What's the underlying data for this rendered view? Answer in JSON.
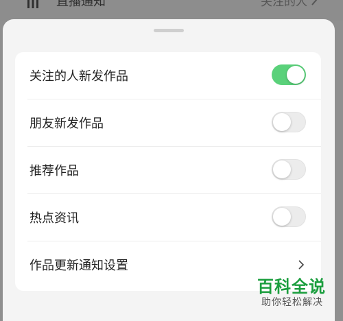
{
  "background_row": {
    "title": "直播通知",
    "value": "关注的人",
    "icon": "bars-icon"
  },
  "settings": {
    "items": [
      {
        "label": "关注的人新发作品",
        "control": "toggle",
        "on": true
      },
      {
        "label": "朋友新发作品",
        "control": "toggle",
        "on": false
      },
      {
        "label": "推荐作品",
        "control": "toggle",
        "on": false
      },
      {
        "label": "热点资讯",
        "control": "toggle",
        "on": false
      },
      {
        "label": "作品更新通知设置",
        "control": "chevron"
      }
    ]
  },
  "watermark": {
    "main": "百科全说",
    "sub": "助你轻松解决"
  },
  "colors": {
    "toggle_on": "#5ad17a",
    "toggle_off": "#ececec",
    "sheet_bg": "#f4f4f4",
    "card_bg": "#ffffff",
    "watermark_green": "#1b9e3e"
  }
}
